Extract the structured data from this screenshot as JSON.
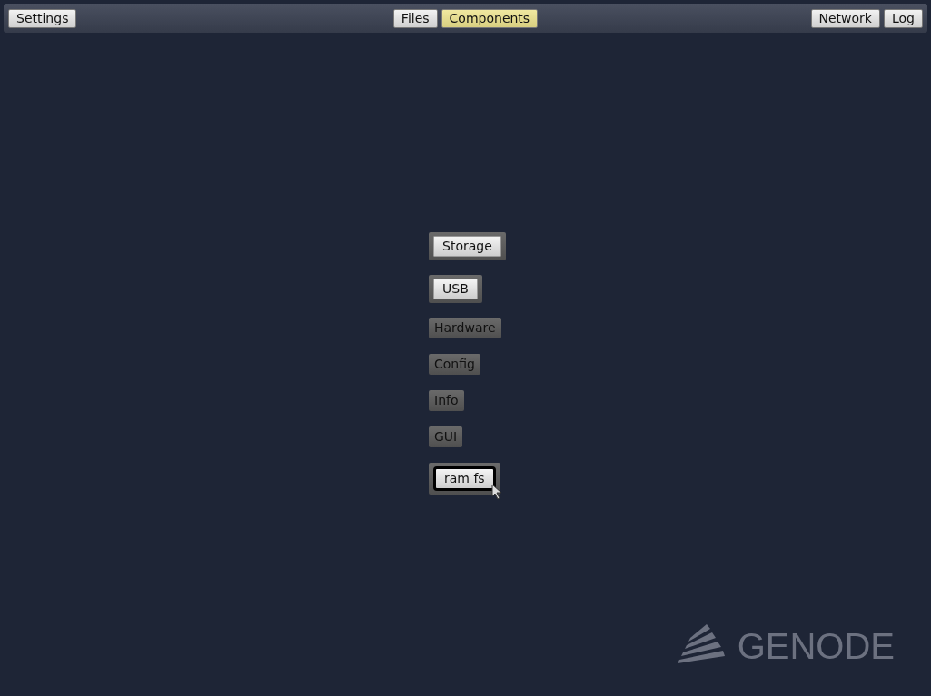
{
  "top_bar": {
    "left": [
      {
        "label": "Settings"
      }
    ],
    "tabs": [
      {
        "label": "Files",
        "selected": false
      },
      {
        "label": "Components",
        "selected": true
      }
    ],
    "right": [
      {
        "label": "Network"
      },
      {
        "label": "Log"
      }
    ]
  },
  "menu": [
    {
      "label": "Storage",
      "kind": "button",
      "hovered": false
    },
    {
      "label": "USB",
      "kind": "button",
      "hovered": false
    },
    {
      "label": "Hardware",
      "kind": "label",
      "hovered": false
    },
    {
      "label": "Config",
      "kind": "label",
      "hovered": false
    },
    {
      "label": "Info",
      "kind": "label",
      "hovered": false
    },
    {
      "label": "GUI",
      "kind": "label",
      "hovered": false
    },
    {
      "label": "ram fs",
      "kind": "button",
      "hovered": true
    }
  ],
  "logo": {
    "text": "GENODE"
  }
}
